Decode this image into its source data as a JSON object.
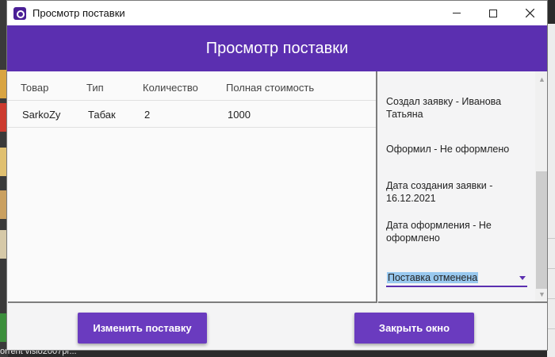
{
  "window": {
    "title": "Просмотр поставки",
    "app_icon": "app-logo-icon",
    "controls": [
      "minimize-icon",
      "maximize-icon",
      "close-icon"
    ]
  },
  "header": {
    "title": "Просмотр поставки"
  },
  "table": {
    "columns": [
      "Товар",
      "Тип",
      "Количество",
      "Полная стоимость"
    ],
    "rows": [
      [
        "SarkoZy",
        "Табак",
        "2",
        "1000"
      ]
    ]
  },
  "info": {
    "created_by": "Создал заявку - Иванова Татьяна",
    "processed_by": "Оформил - Не оформлено",
    "created_date": "Дата создания заявки - 16.12.2021",
    "processed_date": "Дата оформления - Не оформлено",
    "status": "Поставка отменена"
  },
  "buttons": {
    "edit": "Изменить поставку",
    "close": "Закрыть окно"
  },
  "background": {
    "taskbar_label": "orrent   visio2007pr..."
  },
  "colors": {
    "accent": "#5b2fb0",
    "button": "#6a3bbf",
    "selection": "#99c9ef"
  }
}
